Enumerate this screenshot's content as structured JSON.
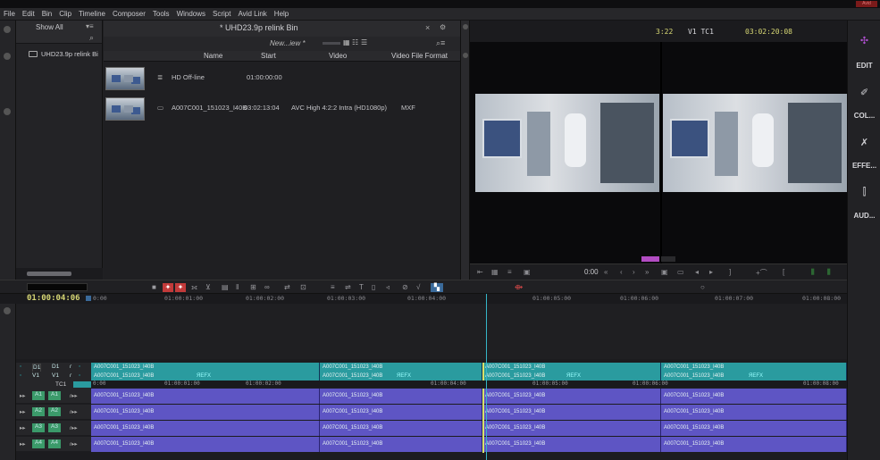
{
  "titlebar": {
    "title": "",
    "app_badge": "Avid"
  },
  "menu": [
    "File",
    "Edit",
    "Bin",
    "Clip",
    "Timeline",
    "Composer",
    "Tools",
    "Windows",
    "Script",
    "Avid Link",
    "Help"
  ],
  "bin": {
    "show_all": "Show All",
    "bin_item": "UHD23.9p relink Bi",
    "window_title": "* UHD23.9p relink Bin",
    "view_name": "New...iew *",
    "columns": [
      "Name",
      "Start",
      "Video",
      "Video File Format"
    ],
    "rows": [
      {
        "name": "HD Off-line",
        "start": "01:00:00:00",
        "video": "",
        "format": ""
      },
      {
        "name": "A007C001_151023_I40B",
        "start": "03:02:13:04",
        "video": "AVC High 4:2:2 Intra (HD1080p)",
        "format": "MXF"
      }
    ]
  },
  "viewer": {
    "duration": "3:22",
    "track_label": "V1  TC1",
    "timecode": "03:02:20:08",
    "ctrl_time": "0:00"
  },
  "rightbar": {
    "edit": "EDIT",
    "color": "COL...",
    "effects": "EFFE...",
    "audio": "AUD..."
  },
  "timeline": {
    "master_tc": "01:00:04:06",
    "ruler": [
      "0:00",
      "01:00:01:00",
      "01:00:02:00",
      "01:00:03:00",
      "01:00:04:00",
      "01:00:05:00",
      "01:00:06:00",
      "01:00:07:00",
      "01:00:08:00"
    ],
    "tracks": [
      {
        "src": "D1",
        "rec": "D1"
      },
      {
        "src": "V1",
        "rec": "V1"
      },
      {
        "src": "",
        "rec": "TC1"
      },
      {
        "src": "A1",
        "rec": "A1"
      },
      {
        "src": "A2",
        "rec": "A2"
      },
      {
        "src": "A3",
        "rec": "A3"
      },
      {
        "src": "A4",
        "rec": "A4"
      }
    ],
    "clip_name": "A007C001_151023_I40B",
    "fx_label": "ЯEFX"
  },
  "colors": {
    "accent_teal": "#2a9b9f",
    "audio_purple": "#5e55c4",
    "timecode_yellow": "#d7d774"
  }
}
